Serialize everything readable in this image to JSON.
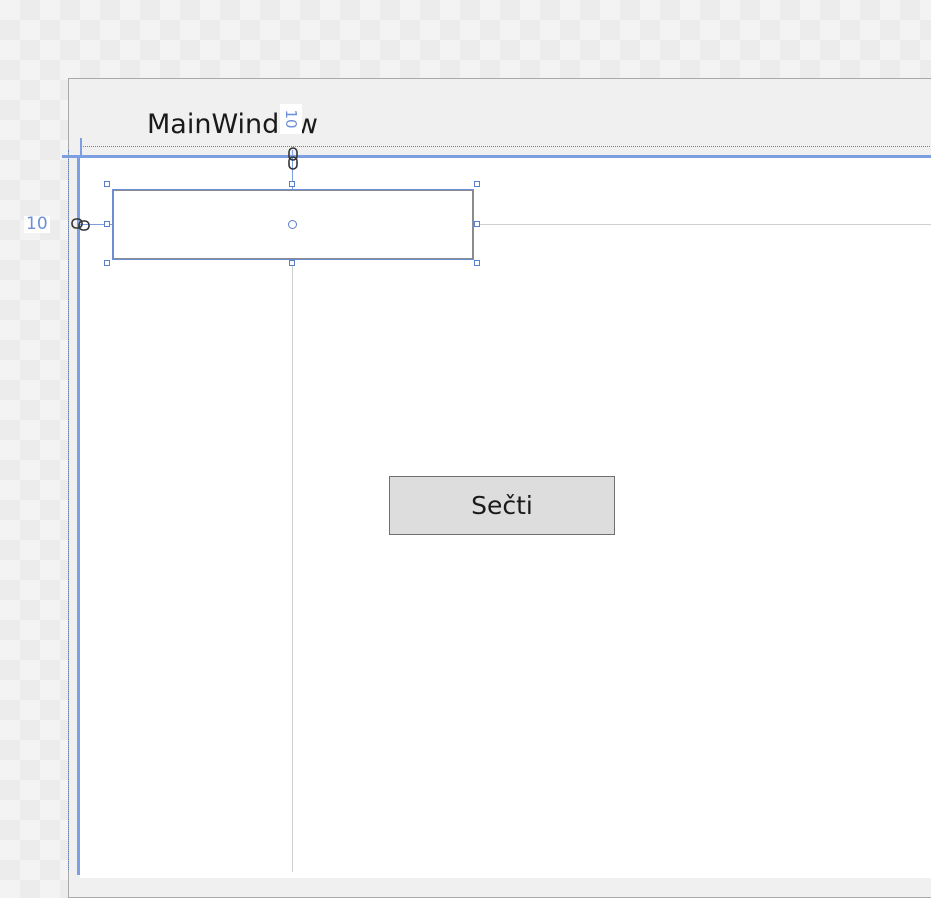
{
  "window": {
    "title": "MainWindow"
  },
  "designer": {
    "left_margin_label": "10",
    "top_margin_label": "10",
    "accent_color": "#7b9fe0"
  },
  "textbox": {
    "value": ""
  },
  "button": {
    "label": "Sečti"
  },
  "icons": {
    "left_anchor": "chain-link-icon",
    "top_anchor": "chain-link-icon"
  }
}
